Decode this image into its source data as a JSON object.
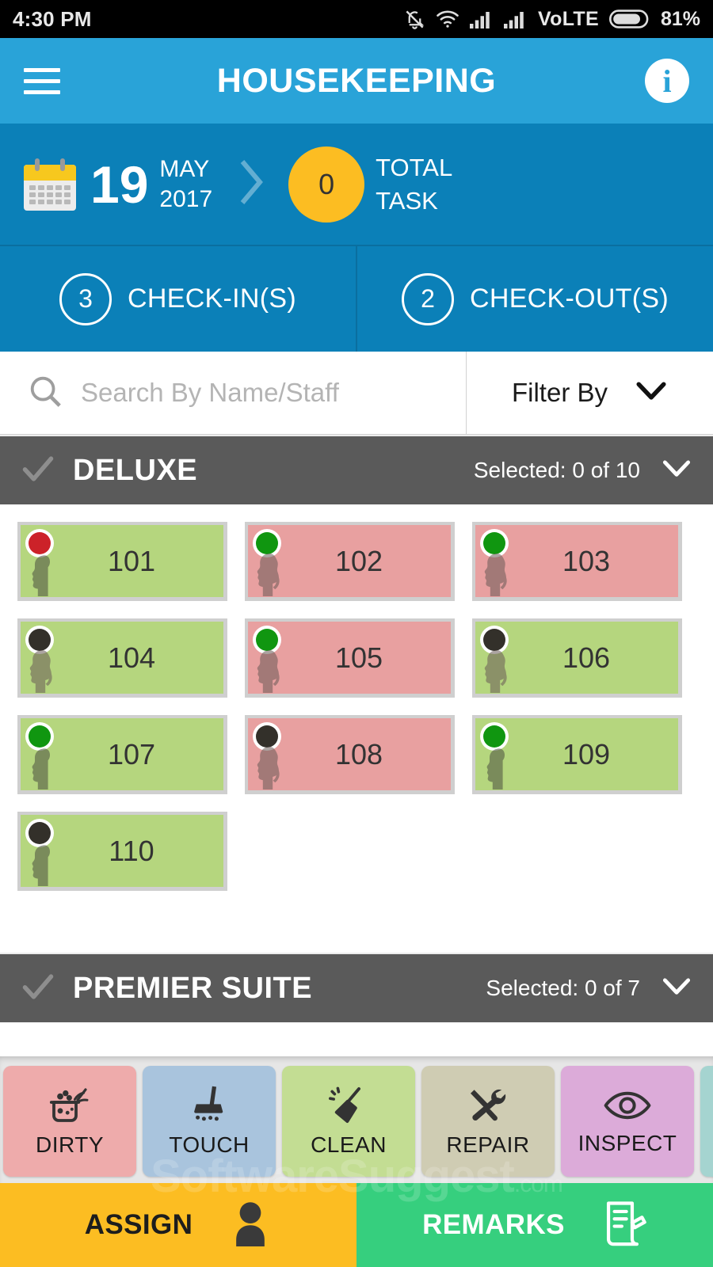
{
  "statusbar": {
    "time": "4:30 PM",
    "network_label": "VoLTE",
    "battery": "81%",
    "icons": [
      "bell-muted-icon",
      "wifi-icon",
      "signal-bars-icon",
      "signal-bars-icon",
      "battery-icon"
    ]
  },
  "appbar": {
    "title": "HOUSEKEEPING",
    "menu_icon": "hamburger-icon",
    "info_label": "i"
  },
  "datebar": {
    "day": "19",
    "month": "MAY",
    "year": "2017",
    "total_count": "0",
    "total_line1": "TOTAL",
    "total_line2": "TASK"
  },
  "checkbar": {
    "checkin_count": "3",
    "checkin_label": "CHECK-IN(S)",
    "checkout_count": "2",
    "checkout_label": "CHECK-OUT(S)"
  },
  "search": {
    "placeholder": "Search By Name/Staff",
    "value": "",
    "filter_label": "Filter By"
  },
  "groups": [
    {
      "title": "DELUXE",
      "selected_text": "Selected: 0 of 10",
      "rooms": [
        {
          "number": "101",
          "state_color": "#b5d67e",
          "dot_color": "#cc2229",
          "occupant": "male"
        },
        {
          "number": "102",
          "state_color": "#e8a0a0",
          "dot_color": "#109610",
          "occupant": "female"
        },
        {
          "number": "103",
          "state_color": "#e8a0a0",
          "dot_color": "#109610",
          "occupant": "female"
        },
        {
          "number": "104",
          "state_color": "#b5d67e",
          "dot_color": "#33302a",
          "occupant": "female"
        },
        {
          "number": "105",
          "state_color": "#e8a0a0",
          "dot_color": "#109610",
          "occupant": "female"
        },
        {
          "number": "106",
          "state_color": "#b5d67e",
          "dot_color": "#33302a",
          "occupant": "female"
        },
        {
          "number": "107",
          "state_color": "#b5d67e",
          "dot_color": "#109610",
          "occupant": "male"
        },
        {
          "number": "108",
          "state_color": "#e8a0a0",
          "dot_color": "#33302a",
          "occupant": "female"
        },
        {
          "number": "109",
          "state_color": "#b5d67e",
          "dot_color": "#109610",
          "occupant": "male"
        },
        {
          "number": "110",
          "state_color": "#b5d67e",
          "dot_color": "#33302a",
          "occupant": "male"
        }
      ]
    },
    {
      "title": "PREMIER SUITE",
      "selected_text": "Selected: 0 of 7",
      "rooms": []
    }
  ],
  "actions": [
    {
      "label": "DIRTY",
      "color": "#eeabab",
      "icon": "laundry-basket-icon"
    },
    {
      "label": "TOUCH",
      "color": "#a9c4dd",
      "icon": "mop-icon"
    },
    {
      "label": "CLEAN",
      "color": "#c3dd93",
      "icon": "broom-icon"
    },
    {
      "label": "REPAIR",
      "color": "#cfccb3",
      "icon": "tools-icon"
    },
    {
      "label": "INSPECT",
      "color": "#dcabd9",
      "icon": "eye-icon"
    },
    {
      "label": "",
      "color": "#a5d4d0",
      "icon": "partial-icon"
    }
  ],
  "bottombar": {
    "assign_label": "ASSIGN",
    "assign_icon": "person-icon",
    "remarks_label": "REMARKS",
    "remarks_icon": "document-pen-icon"
  },
  "watermark": {
    "text": "SoftwareSuggest",
    "suffix": ".com"
  },
  "colors": {
    "appbar": "#29a3d8",
    "datebar": "#0b80b8",
    "accent_yellow": "#fcbd22",
    "group_header": "#5a5a5a",
    "clean_green": "#b5d67e",
    "dirty_pink": "#e8a0a0",
    "remarks_green": "#36cf7e"
  }
}
